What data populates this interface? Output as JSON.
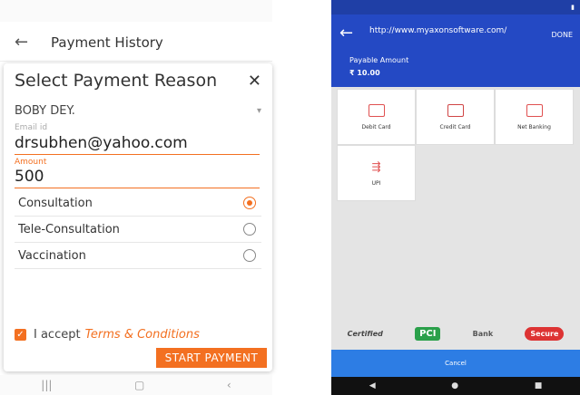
{
  "left": {
    "header_title": "Payment History",
    "dialog_title": "Select Payment Reason",
    "patient_name": "BOBY DEY.",
    "email_label": "Email id",
    "email_value": "drsubhen@yahoo.com",
    "amount_label": "Amount",
    "amount_value": "500",
    "reasons": [
      {
        "label": "Consultation",
        "selected": true
      },
      {
        "label": "Tele-Consultation",
        "selected": false
      },
      {
        "label": "Vaccination",
        "selected": false
      }
    ],
    "accept_text": "I accept",
    "terms_text": "Terms & Conditions",
    "start_button": "START PAYMENT"
  },
  "right": {
    "url": "http://www.myaxonsoftware.com/",
    "done_label": "DONE",
    "payable_label": "Payable Amount",
    "payable_amount": "₹ 10.00",
    "methods": [
      "Debit Card",
      "Credit Card",
      "Net Banking",
      "UPI"
    ],
    "logos": [
      "Certified",
      "PCI",
      "Bank",
      "Secure"
    ],
    "cancel_label": "Cancel"
  },
  "colors": {
    "accent": "#f37021",
    "blue": "#2449c4"
  }
}
